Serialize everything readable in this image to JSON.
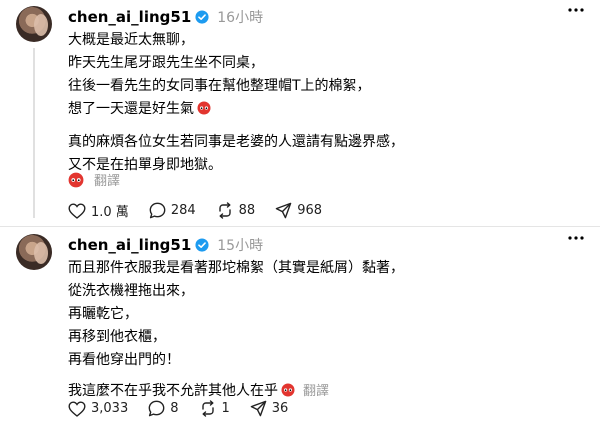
{
  "posts": [
    {
      "username": "chen_ai_ling51",
      "time": "16小時",
      "lines": [
        "大概是最近太無聊，",
        "昨天先生尾牙跟先生坐不同桌，",
        "往後一看先生的女同事在幫他整理帽T上的棉絮，",
        "想了一天還是好生氣"
      ],
      "lines2": [
        "真的麻煩各位女生若同事是老婆的人還請有點邊界感，",
        "又不是在拍單身即地獄。"
      ],
      "translate_label": "翻譯",
      "likes": "1.0 萬",
      "comments": "284",
      "reposts": "88",
      "shares": "968"
    },
    {
      "username": "chen_ai_ling51",
      "time": "15小時",
      "lines": [
        "而且那件衣服我是看著那坨棉絮（其實是紙屑）黏著，",
        "從洗衣機裡拖出來，",
        "再曬乾它，",
        "再移到他衣櫃，",
        "再看他穿出門的！"
      ],
      "last_line": "我這麼不在乎我不允許其他人在乎",
      "translate_label": "翻譯",
      "likes": "3,033",
      "comments": "8",
      "reposts": "1",
      "shares": "36"
    }
  ],
  "icons": {
    "verified": "verified-badge-icon",
    "more": "more-icon",
    "emoji": "angry-face-emoji-icon",
    "like": "heart-icon",
    "comment": "comment-icon",
    "repost": "repost-icon",
    "share": "share-icon"
  },
  "colors": {
    "verified": "#1d9bf0",
    "emoji": "#e2352f",
    "muted": "#999999"
  }
}
